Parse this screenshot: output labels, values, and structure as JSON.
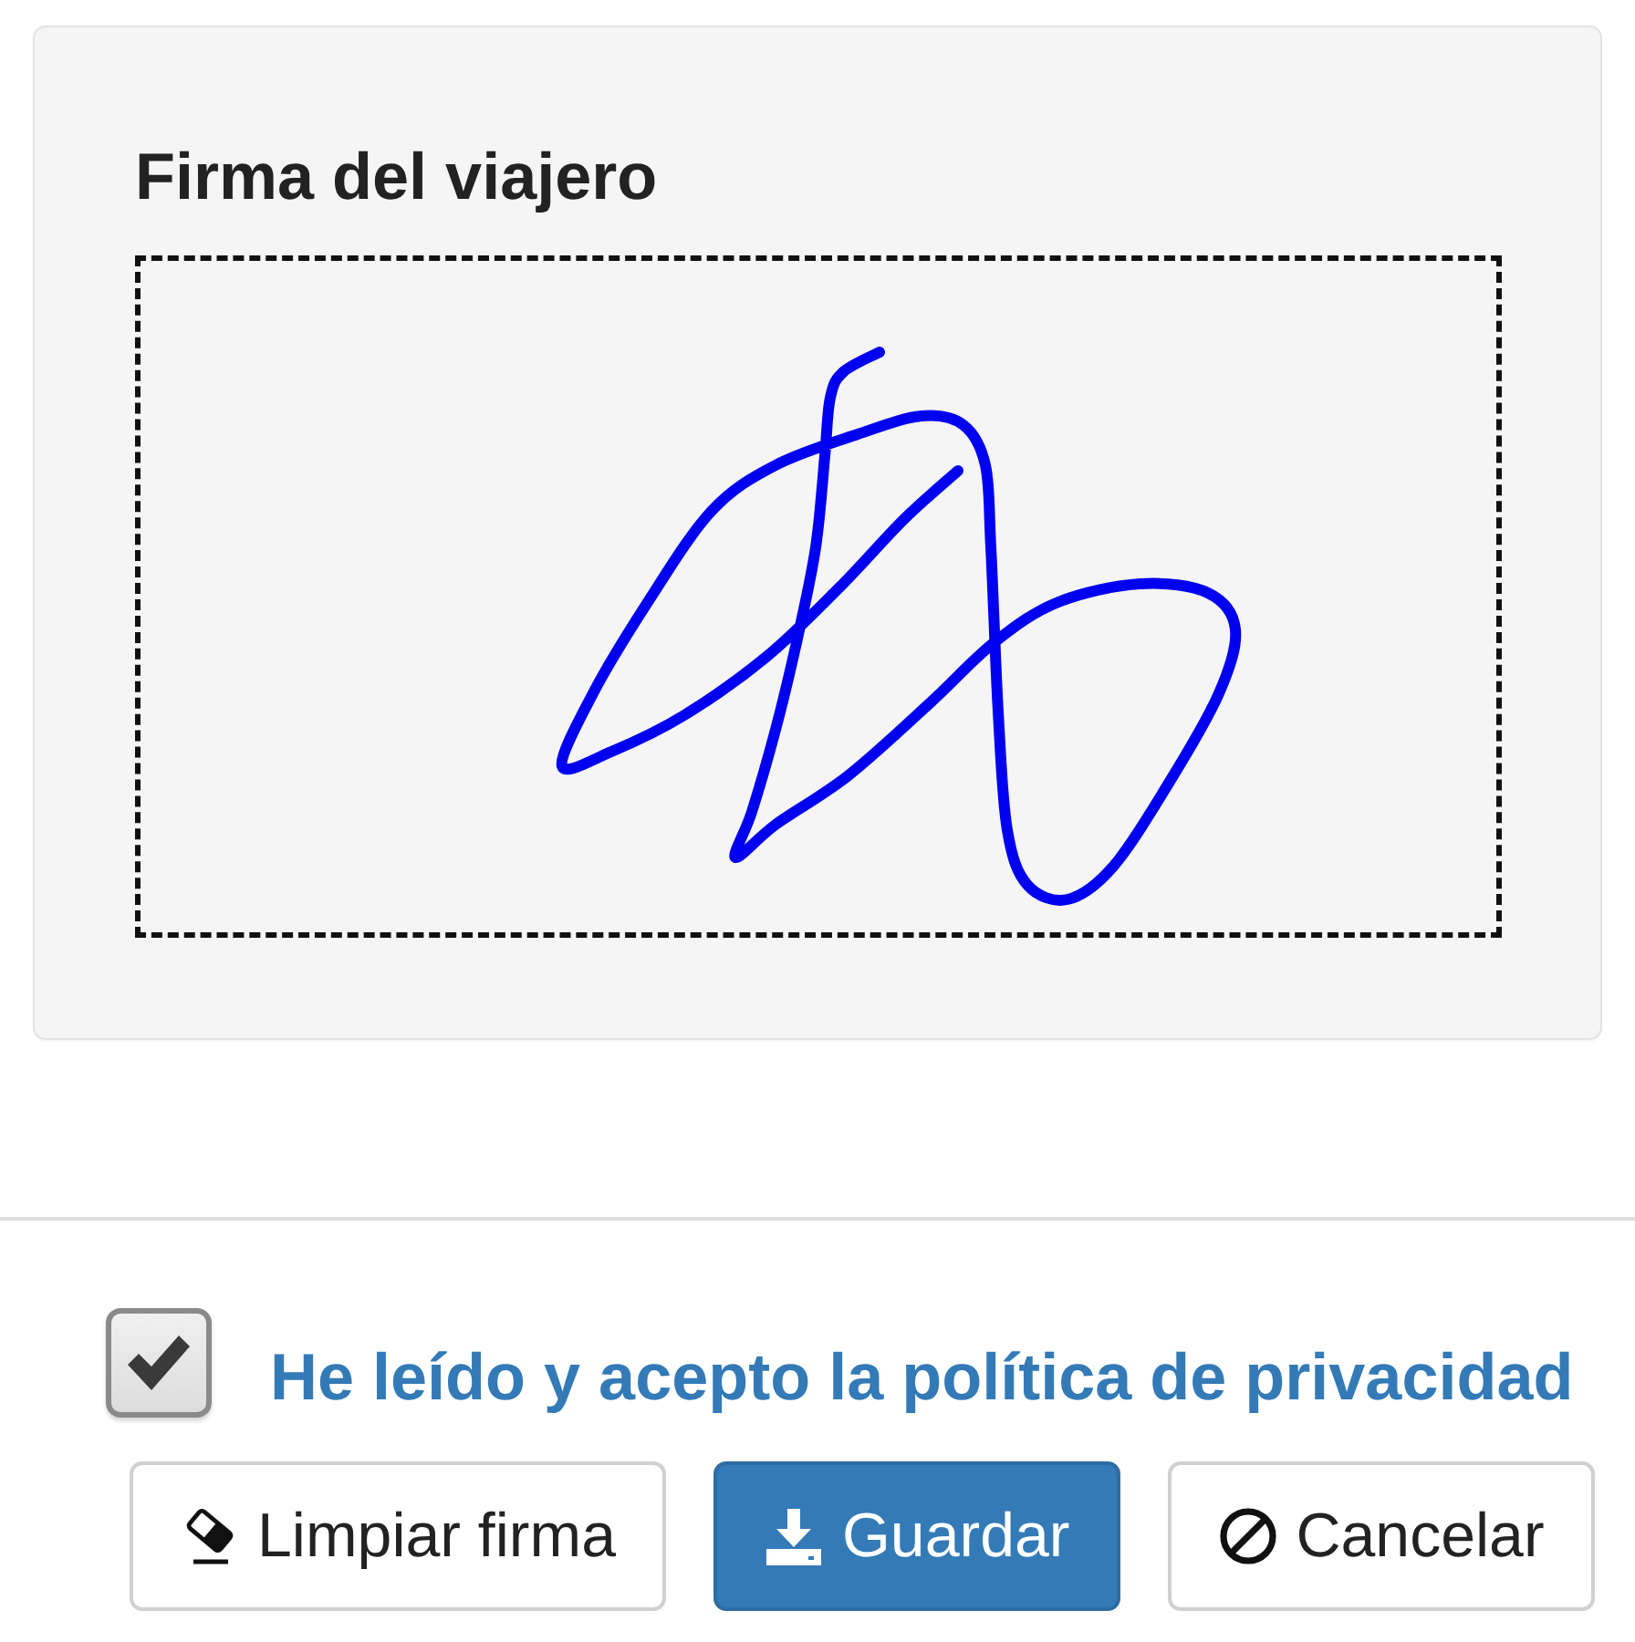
{
  "signature_panel": {
    "title": "Firma del viajero",
    "signed": true
  },
  "consent": {
    "label": "He leído y acepto la política de privacidad",
    "checked": true
  },
  "buttons": [
    {
      "label": "Limpiar firma",
      "kind": "clear"
    },
    {
      "label": "Guardar",
      "kind": "save"
    },
    {
      "label": "Cancelar",
      "kind": "cancel"
    }
  ]
}
